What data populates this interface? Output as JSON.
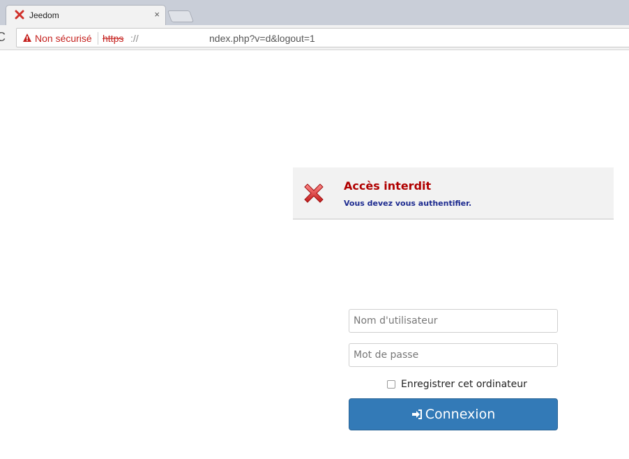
{
  "browser": {
    "tab_title": "Jeedom",
    "tab_close": "×",
    "reload": "C",
    "security_label": "Non sécurisé",
    "url_scheme": "https",
    "url_sep": "://",
    "url_path": "ndex.php?v=d&logout=1"
  },
  "alert": {
    "title": "Accès interdit",
    "message": "Vous devez vous authentifier."
  },
  "form": {
    "username_placeholder": "Nom d'utilisateur",
    "password_placeholder": "Mot de passe",
    "remember_label": "Enregistrer cet ordinateur",
    "remember_checked": false,
    "login_label": "Connexion"
  },
  "colors": {
    "primary": "#337ab7",
    "error": "#b00000",
    "message": "#1c2a8f"
  }
}
